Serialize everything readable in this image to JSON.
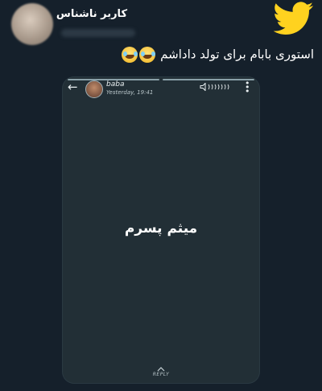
{
  "tweet": {
    "username": "کاربر ناشناس",
    "text": "استوری بابام برای تولد داداشم",
    "emoji": [
      "face-with-tears-of-joy",
      "face-with-tears-of-joy"
    ]
  },
  "brand": {
    "icon": "twitter-bird-icon",
    "color": "#ffd21f"
  },
  "story": {
    "contact_name": "baba",
    "timestamp": "Yesterday, 19:41",
    "message": "میثم پسرم",
    "reply_label": "REPLY",
    "segments": 2,
    "background_color": "#222f36"
  }
}
